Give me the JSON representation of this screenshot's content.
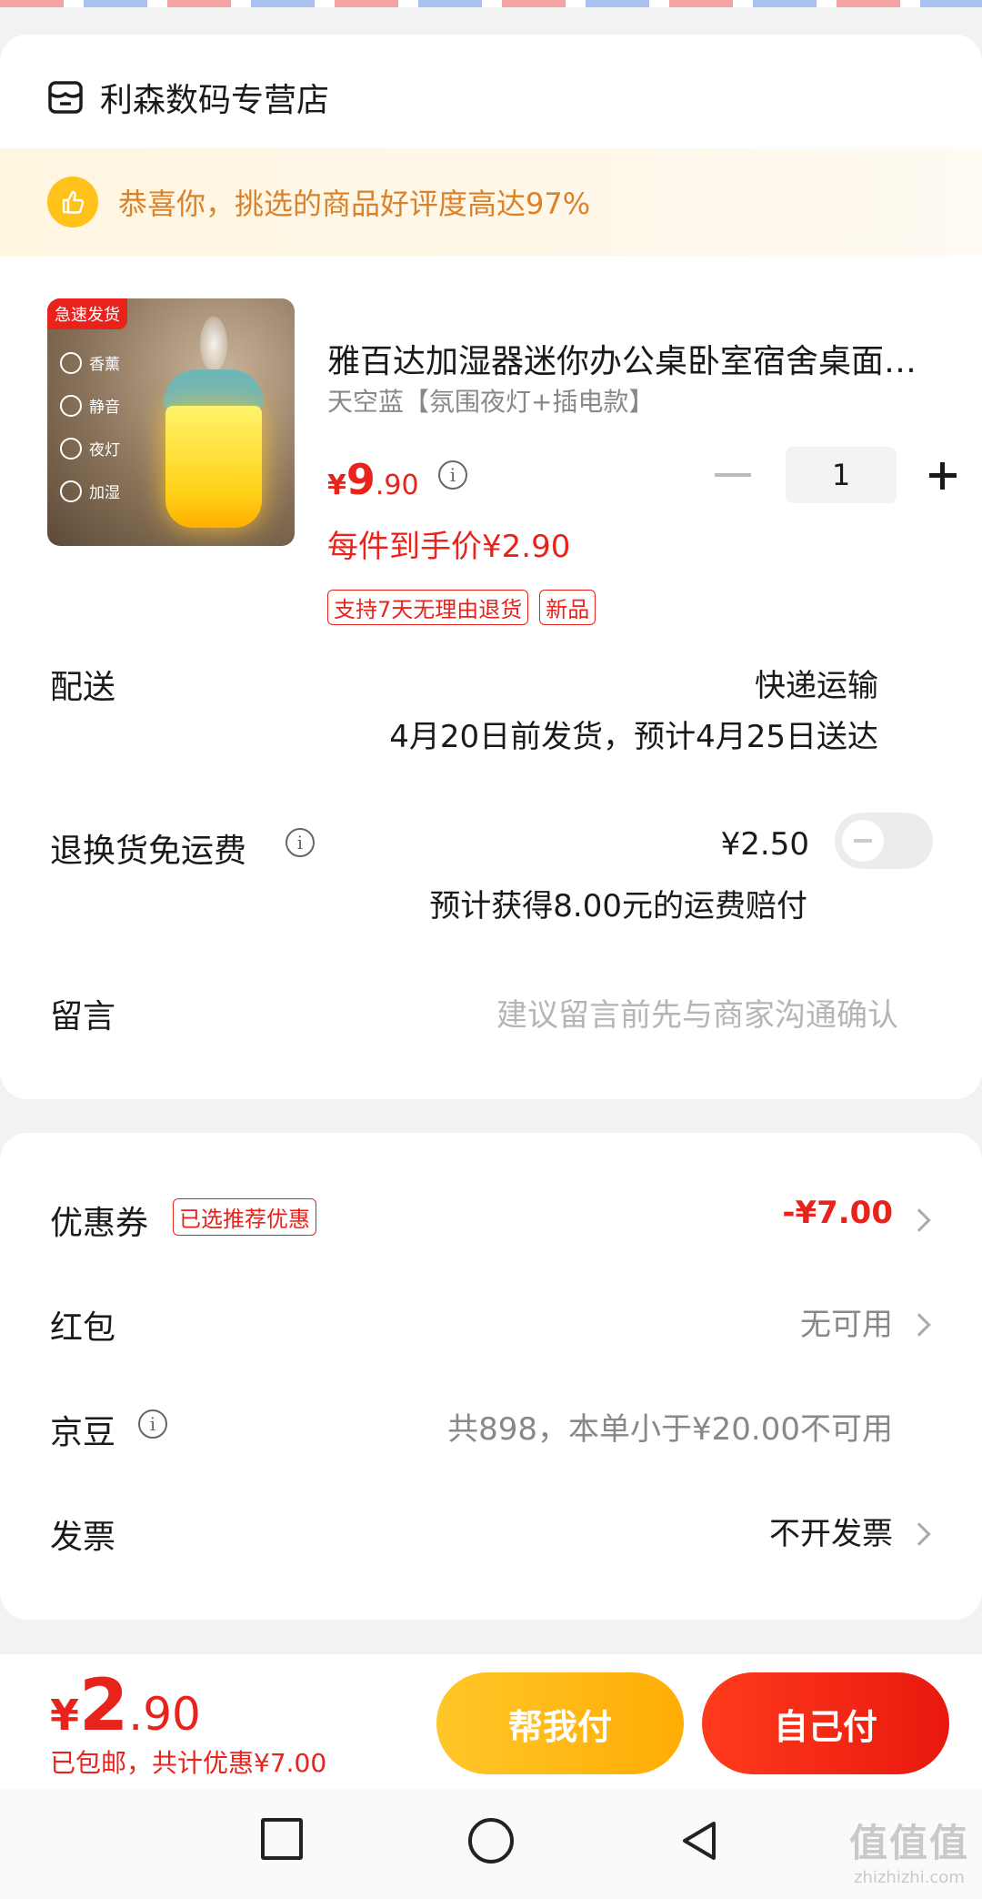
{
  "store": {
    "name": "利森数码专营店",
    "icon": "store-icon"
  },
  "banner": {
    "text": "恭喜你，挑选的商品好评度高达97%",
    "icon": "thumb-up-icon"
  },
  "product": {
    "image_tag": "急速发货",
    "image_features": [
      "香薰",
      "静音",
      "夜灯",
      "加湿"
    ],
    "title": "雅百达加湿器迷你办公桌卧室宿舍桌面小型家用喷雾",
    "spec": "天空蓝【氛围夜灯+插电款】",
    "price_symbol": "¥",
    "price_int": "9",
    "price_dec": ".90",
    "quantity": "1",
    "net_price": "每件到手价¥2.90",
    "tags": [
      "支持7天无理由退货",
      "新品"
    ]
  },
  "delivery": {
    "label": "配送",
    "method": "快递运输",
    "schedule": "4月20日前发货，预计4月25日送达"
  },
  "return_shipping": {
    "label": "退换货免运费",
    "price": "¥2.50",
    "note": "预计获得8.00元的运费赔付",
    "enabled": false
  },
  "message": {
    "label": "留言",
    "placeholder": "建议留言前先与商家沟通确认"
  },
  "discounts": {
    "coupon": {
      "label": "优惠券",
      "tag": "已选推荐优惠",
      "value": "-¥7.00"
    },
    "red_packet": {
      "label": "红包",
      "value": "无可用"
    },
    "jd_beans": {
      "label": "京豆",
      "value": "共898，本单小于¥20.00不可用"
    },
    "invoice": {
      "label": "发票",
      "value": "不开发票"
    }
  },
  "footer": {
    "price_symbol": "¥",
    "price_int": "2",
    "price_dec": ".90",
    "subtext": "已包邮，共计优惠¥7.00",
    "help_pay": "帮我付",
    "self_pay": "自己付"
  },
  "watermark": {
    "brand": "值值值",
    "site": "zhizhizhi.com"
  },
  "colors": {
    "accent_red": "#e8231c",
    "accent_yellow": "#ffc629",
    "banner_text": "#d9822b"
  }
}
